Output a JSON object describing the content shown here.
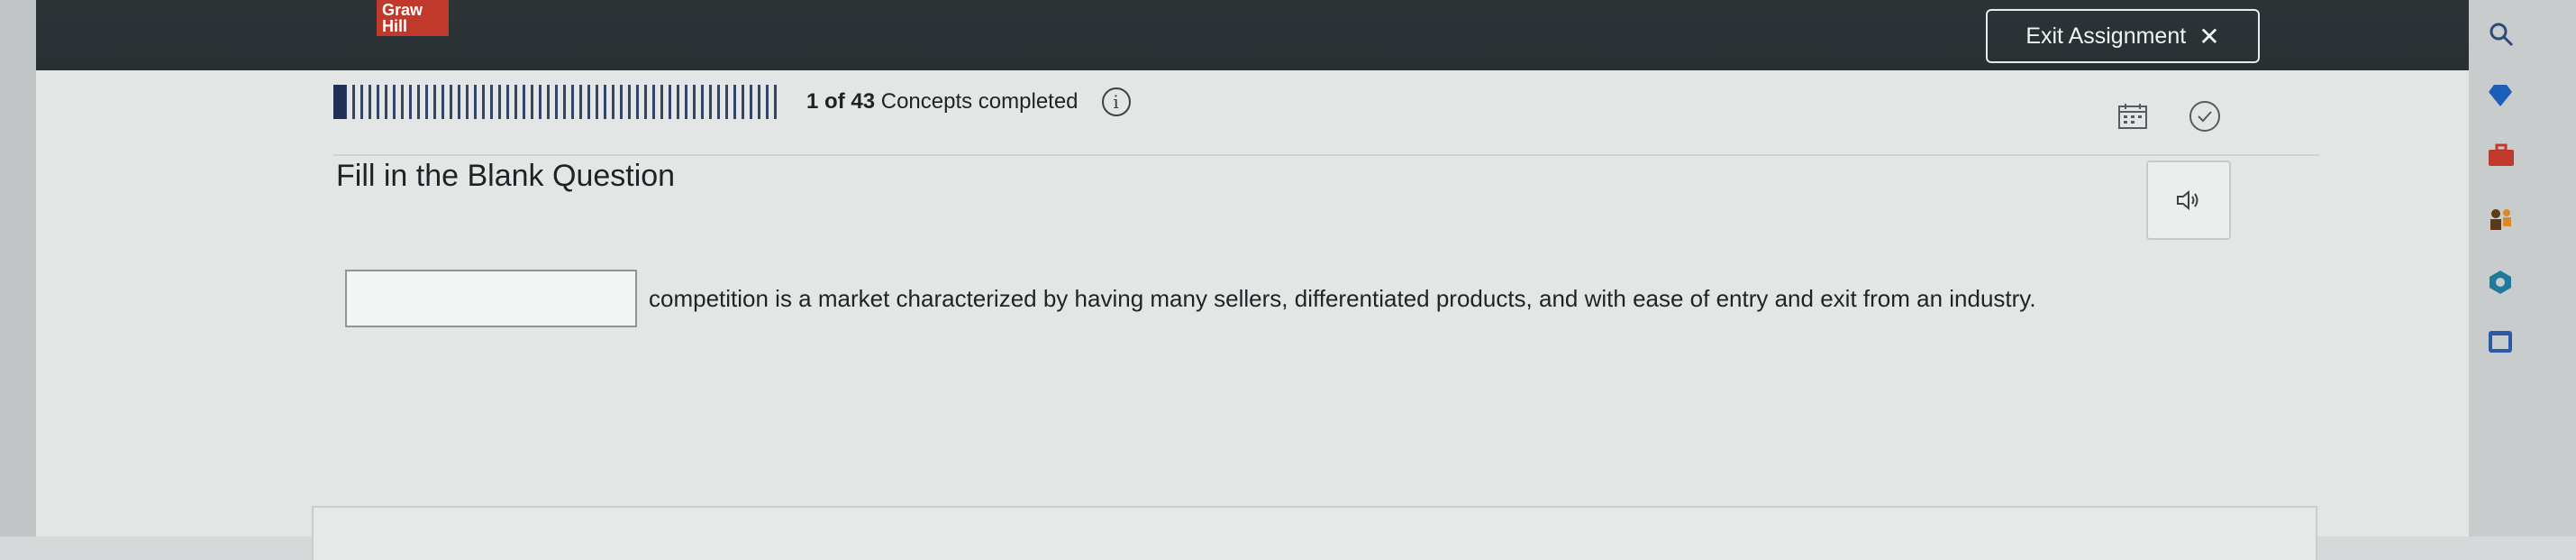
{
  "header": {
    "logo_text": "Graw\nHill",
    "exit_label": "Exit Assignment",
    "exit_icon": "close-icon"
  },
  "progress": {
    "completed": "1",
    "total": "43",
    "of_text": "of",
    "label": "Concepts completed",
    "fraction": 0.023,
    "info_icon": "info-icon"
  },
  "toolbar": {
    "calendar_icon": "calendar-icon",
    "check_icon": "checkmark-circle-icon"
  },
  "question": {
    "title": "Fill in the Blank Question",
    "audio_icon": "speaker-icon",
    "blank_value": "",
    "text": "competition is a market characterized by having many sellers, differentiated products, and with ease of entry and exit from an industry."
  },
  "sidebar": {
    "icons": [
      "search-icon",
      "diamond-icon",
      "briefcase-icon",
      "people-icon",
      "hexagon-icon",
      "window-icon"
    ]
  },
  "colors": {
    "header_bg": "#2d3437",
    "logo_red": "#c0392b",
    "progress_blue": "#1f2f55"
  }
}
